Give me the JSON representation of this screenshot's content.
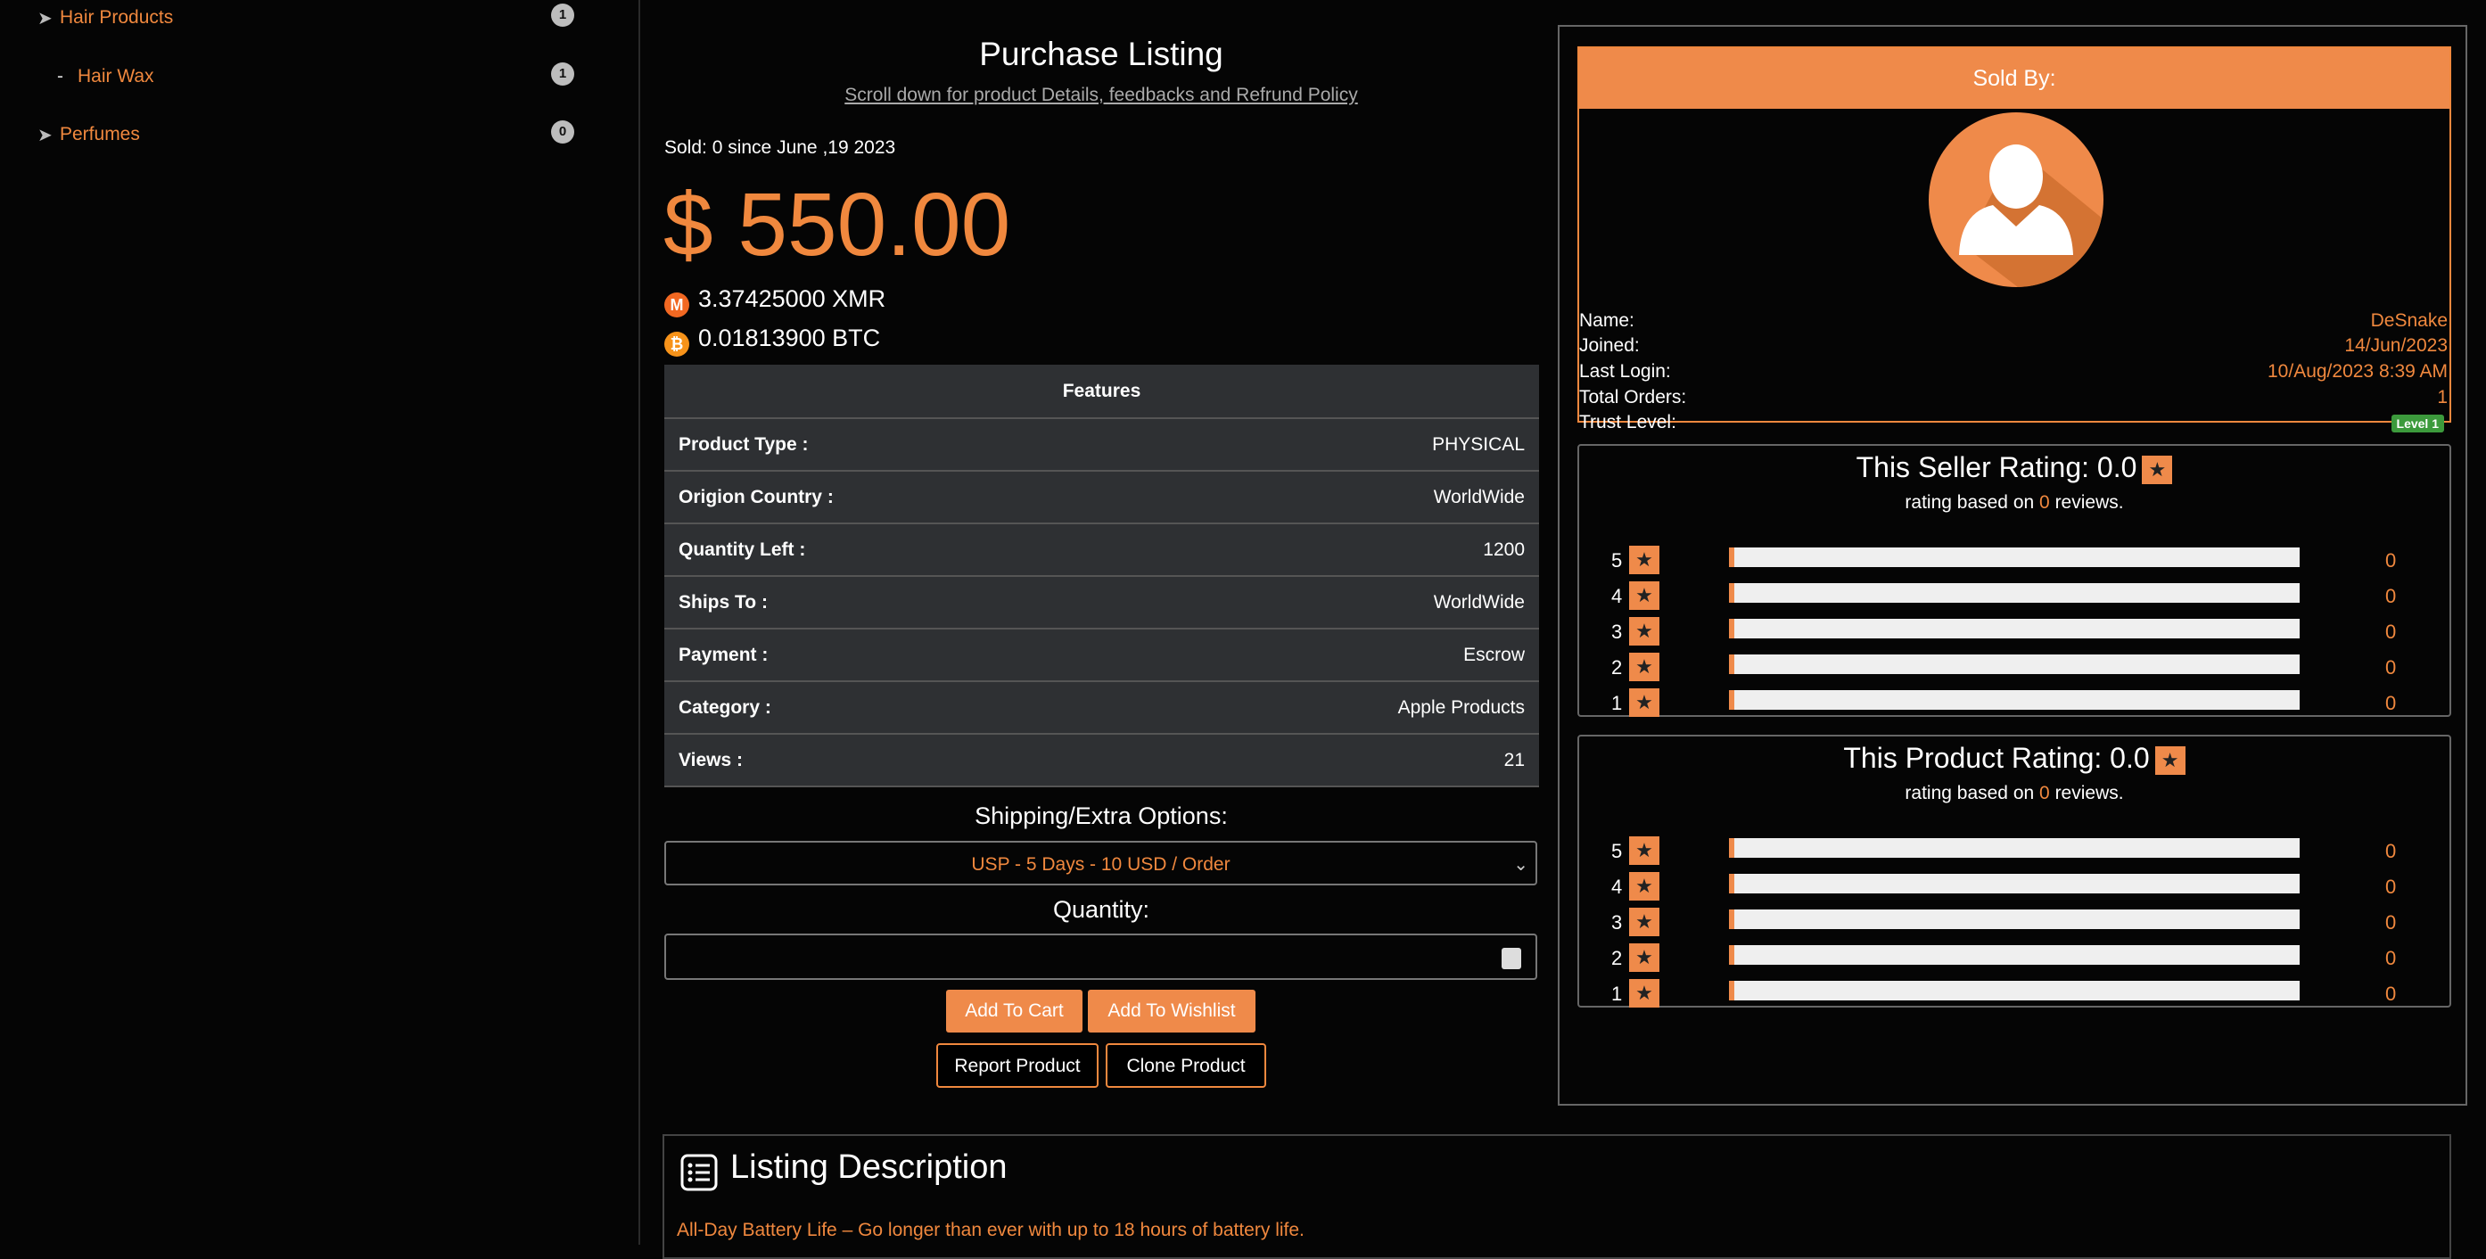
{
  "sidebar": {
    "categories": [
      {
        "label": "Hair Products",
        "count": "1"
      },
      {
        "label": "Hair Wax",
        "count": "1"
      },
      {
        "label": "Perfumes",
        "count": "0"
      }
    ]
  },
  "listing": {
    "title": "Purchase Listing",
    "subtitle": "Scroll down for product Details, feedbacks and Refrund Policy",
    "sold_info": "Sold: 0 since June ,19 2023",
    "price": "$ 550.00",
    "xmr": "3.37425000 XMR",
    "btc": "0.01813900 BTC"
  },
  "features": {
    "header": "Features",
    "rows": [
      {
        "key": "Product Type :",
        "value": "PHYSICAL"
      },
      {
        "key": "Origion Country :",
        "value": "WorldWide"
      },
      {
        "key": "Quantity Left :",
        "value": "1200"
      },
      {
        "key": "Ships To :",
        "value": "WorldWide"
      },
      {
        "key": "Payment :",
        "value": "Escrow"
      },
      {
        "key": "Category :",
        "value": "Apple Products"
      },
      {
        "key": "Views :",
        "value": "21"
      }
    ]
  },
  "options": {
    "shipping_label": "Shipping/Extra Options:",
    "shipping_selected": "USP - 5 Days - 10 USD / Order",
    "quantity_label": "Quantity:"
  },
  "buttons": {
    "add_to_cart": "Add To Cart",
    "add_to_wishlist": "Add To Wishlist",
    "report": "Report Product",
    "clone": "Clone Product"
  },
  "seller": {
    "header": "Sold By:",
    "name_label": "Name:",
    "name": "DeSnake",
    "joined_label": "Joined:",
    "joined": "14/Jun/2023",
    "last_login_label": "Last Login:",
    "last_login": "10/Aug/2023 8:39 AM",
    "orders_label": "Total Orders:",
    "orders": "1",
    "trust_label": "Trust Level:",
    "trust": "Level 1"
  },
  "seller_rating": {
    "title": "This Seller Rating: 0.0",
    "sub_prefix": "rating based on",
    "reviews": "0",
    "sub_suffix": "reviews.",
    "rows": [
      {
        "stars": "5",
        "count": "0",
        "fraction": 0
      },
      {
        "stars": "4",
        "count": "0",
        "fraction": 0
      },
      {
        "stars": "3",
        "count": "0",
        "fraction": 0
      },
      {
        "stars": "2",
        "count": "0",
        "fraction": 0
      },
      {
        "stars": "1",
        "count": "0",
        "fraction": 0
      }
    ]
  },
  "product_rating": {
    "title": "This Product Rating: 0.0",
    "sub_prefix": "rating based on",
    "reviews": "0",
    "sub_suffix": "reviews.",
    "rows": [
      {
        "stars": "5",
        "count": "0",
        "fraction": 0
      },
      {
        "stars": "4",
        "count": "0",
        "fraction": 0
      },
      {
        "stars": "3",
        "count": "0",
        "fraction": 0
      },
      {
        "stars": "2",
        "count": "0",
        "fraction": 0
      },
      {
        "stars": "1",
        "count": "0",
        "fraction": 0
      }
    ]
  },
  "description": {
    "title": "Listing Description",
    "text": "All-Day Battery Life – Go longer than ever with up to 18 hours of battery life."
  },
  "colors": {
    "accent": "#f0883e",
    "background": "#050505",
    "table": "#2e3033",
    "trust_badge": "#3c9a3c"
  }
}
